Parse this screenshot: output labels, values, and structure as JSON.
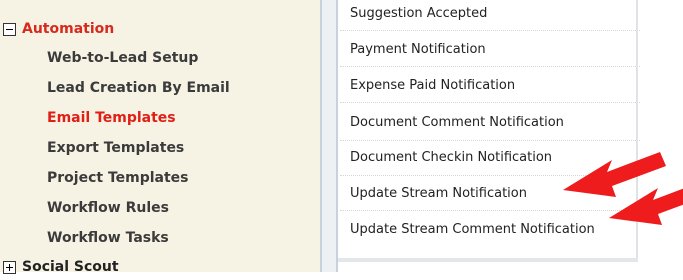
{
  "sidebar": {
    "sections": [
      {
        "label": "Automation",
        "state": "expanded"
      },
      {
        "label": "Social Scout",
        "state": "collapsed"
      }
    ],
    "automation_items": [
      {
        "label": "Web-to-Lead Setup",
        "active": false
      },
      {
        "label": "Lead Creation By Email",
        "active": false
      },
      {
        "label": "Email Templates",
        "active": true
      },
      {
        "label": "Export Templates",
        "active": false
      },
      {
        "label": "Project Templates",
        "active": false
      },
      {
        "label": "Workflow Rules",
        "active": false
      },
      {
        "label": "Workflow Tasks",
        "active": false
      }
    ]
  },
  "templates": [
    "Suggestion Accepted",
    "Payment Notification",
    "Expense Paid Notification",
    "Document Comment Notification",
    "Document Checkin Notification",
    "Update Stream Notification",
    "Update Stream Comment Notification"
  ],
  "colors": {
    "accent_red": "#e01f17",
    "sidebar_bg": "#f7f3e4"
  }
}
